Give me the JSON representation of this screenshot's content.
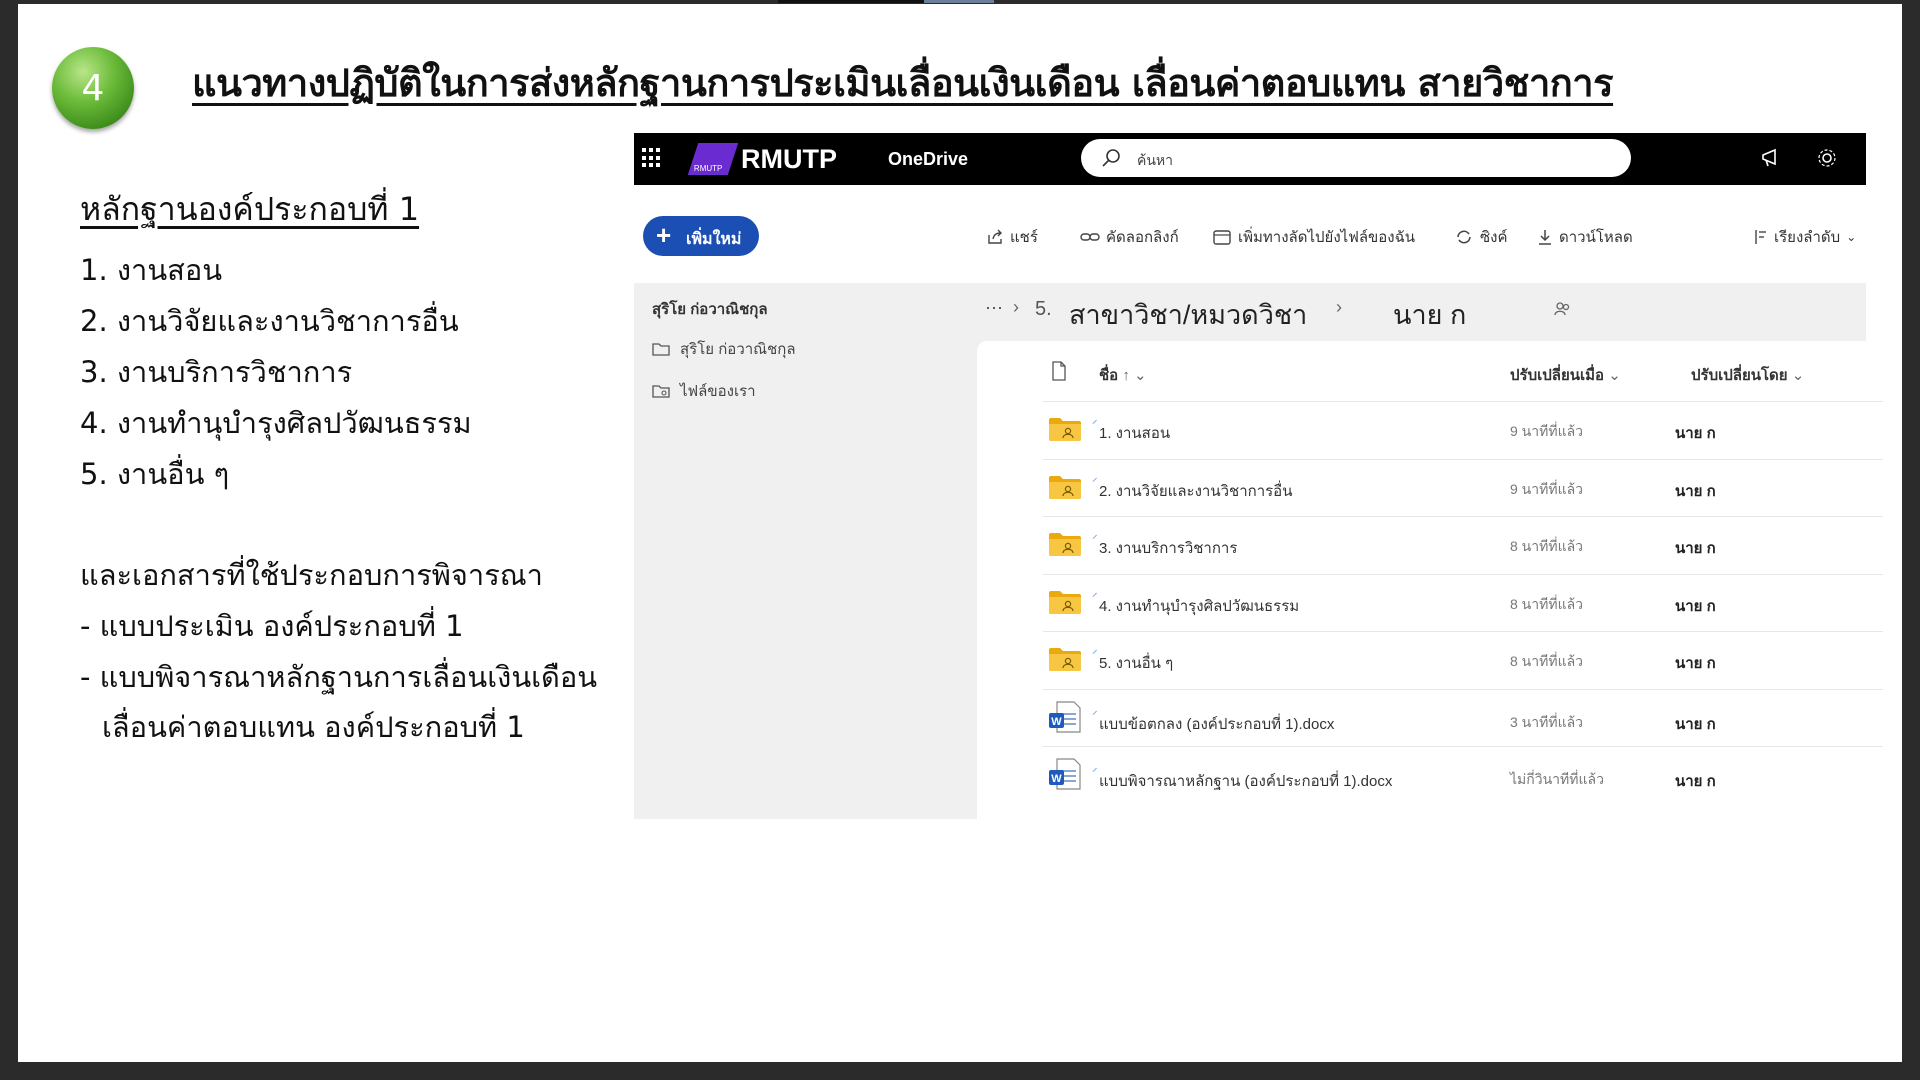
{
  "slide": {
    "number": "4",
    "title": "แนวทางปฏิบัติในการส่งหลักฐานการประเมินเลื่อนเงินเดือน เลื่อนค่าตอบแทน สายวิชาการ",
    "heading": "หลักฐานองค์ประกอบที่ 1",
    "items": [
      "1. งานสอน",
      "2. งานวิจัยและงานวิชาการอื่น",
      "3. งานบริการวิชาการ",
      "4. งานทำนุบำรุงศิลปวัฒนธรรม",
      "5. งานอื่น ๆ"
    ],
    "docs_heading": "และเอกสารที่ใช้ประกอบการพิจารณา",
    "docs": [
      "- แบบประเมิน องค์ประกอบที่ 1",
      "- แบบพิจารณาหลักฐานการเลื่อนเงินเดือน",
      "เลื่อนค่าตอบแทน องค์ประกอบที่ 1"
    ]
  },
  "onedrive": {
    "brand": "RMUTP",
    "logo_small": "RMUTP",
    "app_name": "OneDrive",
    "search_placeholder": "ค้นหา",
    "new_button": "เพิ่มใหม่",
    "commands": {
      "share": "แชร์",
      "copy_link": "คัดลอกลิงก์",
      "add_shortcut": "เพิ่มทางลัดไปยังไฟล์ของฉัน",
      "sync": "ซิงค์",
      "download": "ดาวน์โหลด",
      "sort": "เรียงลำดับ"
    },
    "sidebar": {
      "owner": "สุริโย ก่อวาณิชกุล",
      "links": [
        "สุริโย ก่อวาณิชกุล",
        "ไฟล์ของเรา"
      ]
    },
    "breadcrumb": {
      "ellipsis": "···",
      "number": "5.",
      "folder": "สาขาวิชา/หมวดวิชา",
      "current": "นาย ก"
    },
    "columns": {
      "name": "ชื่อ",
      "modified": "ปรับเปลี่ยนเมื่อ",
      "modified_by": "ปรับเปลี่ยนโดย"
    },
    "files": [
      {
        "name": "1. งานสอน",
        "type": "folder",
        "modified": "9 นาทีที่แล้ว",
        "modified_by": "นาย ก"
      },
      {
        "name": "2. งานวิจัยและงานวิชาการอื่น",
        "type": "folder",
        "modified": "9 นาทีที่แล้ว",
        "modified_by": "นาย ก"
      },
      {
        "name": "3. งานบริการวิชาการ",
        "type": "folder",
        "modified": "8 นาทีที่แล้ว",
        "modified_by": "นาย ก"
      },
      {
        "name": "4. งานทำนุบำรุงศิลปวัฒนธรรม",
        "type": "folder",
        "modified": "8 นาทีที่แล้ว",
        "modified_by": "นาย ก"
      },
      {
        "name": "5. งานอื่น ๆ",
        "type": "folder",
        "modified": "8 นาทีที่แล้ว",
        "modified_by": "นาย ก"
      },
      {
        "name": "แบบข้อตกลง (องค์ประกอบที่ 1).docx",
        "type": "word",
        "modified": "3 นาทีที่แล้ว",
        "modified_by": "นาย ก"
      },
      {
        "name": "แบบพิจารณาหลักฐาน (องค์ประกอบที่ 1).docx",
        "type": "word",
        "modified": "ไม่กี่วินาทีที่แล้ว",
        "modified_by": "นาย ก"
      }
    ]
  },
  "colors": {
    "accent_blue": "#1c4fb3",
    "badge_green": "#4f9e24",
    "brand_purple": "#6a2bd0",
    "folder_yellow": "#f2b820"
  }
}
